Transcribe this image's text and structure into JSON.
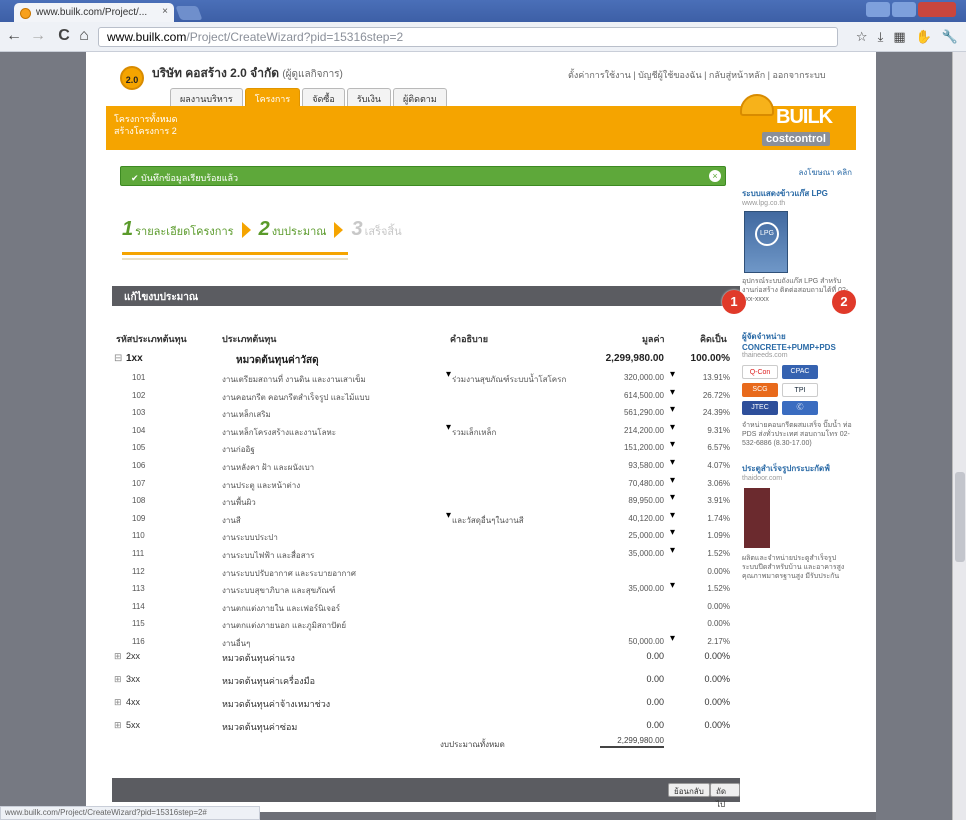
{
  "browser": {
    "tab_title": "www.builk.com/Project/...",
    "tab_close": "×",
    "url_host": "www.builk.com",
    "url_path": "/Project/CreateWizard?pid=15316step=2",
    "back": "←",
    "forward": "→",
    "reload": "C",
    "home": "⌂",
    "status_url": "www.builk.com/Project/CreateWizard?pid=15316step=2#"
  },
  "header": {
    "logo_badge": "2.0",
    "company_name": "บริษัท คอสร้าง 2.0 จำกัด",
    "company_sub": "(ผู้ดูแลกิจการ)",
    "top_links": "ตั้งค่าการใช้งาน | บัญชีผู้ใช้ของฉัน | กลับสู่หน้าหลัก | ออกจากระบบ",
    "menu": [
      "ผลงานบริหาร",
      "โครงการ",
      "จัดซื้อ",
      "รับเงิน",
      "ผู้ติดตาม"
    ],
    "breadcrumb_line1": "โครงการทั้งหมด",
    "breadcrumb_line2": "สร้างโครงการ 2",
    "brand_word": "BUILK",
    "brand_badge": "costcontrol"
  },
  "notice": {
    "text": "✔ บันทึกข้อมูลเรียบร้อยแล้ว",
    "close": "×"
  },
  "steps": [
    {
      "num": "1",
      "label": "รายละเอียดโครงการ"
    },
    {
      "num": "2",
      "label": "งบประมาณ"
    },
    {
      "num": "3",
      "label": "เสร็จสิ้น"
    }
  ],
  "section_title": "แก้ไขงบประมาณ",
  "columns": {
    "code": "รหัสประเภทต้นทุน",
    "type": "ประเภทต้นทุน",
    "desc": "คำอธิบาย",
    "amount": "มูลค่า",
    "percent": "คิดเป็น"
  },
  "main_group": {
    "code": "1xx",
    "name": "หมวดต้นทุนค่าวัสดุ",
    "amount": "2,299,980.00",
    "percent": "100.00%"
  },
  "rows": [
    {
      "code": "101",
      "name": "งานเตรียมสถานที่ งานดิน และงานเสาเข็ม",
      "desc": "ร่วมงานสุขภัณฑ์ระบบน้ำโสโครก",
      "amount": "320,000.00",
      "percent": "13.91%"
    },
    {
      "code": "102",
      "name": "งานคอนกรีต คอนกรีตสำเร็จรูป และไม้แบบ",
      "desc": "",
      "amount": "614,500.00",
      "percent": "26.72%"
    },
    {
      "code": "103",
      "name": "งานเหล็กเสริม",
      "desc": "",
      "amount": "561,290.00",
      "percent": "24.39%"
    },
    {
      "code": "104",
      "name": "งานเหล็กโครงสร้างและงานโลหะ",
      "desc": "รวมเล็กเหล็ก",
      "amount": "214,200.00",
      "percent": "9.31%"
    },
    {
      "code": "105",
      "name": "งานก่ออิฐ",
      "desc": "",
      "amount": "151,200.00",
      "percent": "6.57%"
    },
    {
      "code": "106",
      "name": "งานหลังคา ฝ้า และผนังเบา",
      "desc": "",
      "amount": "93,580.00",
      "percent": "4.07%"
    },
    {
      "code": "107",
      "name": "งานประตู และหน้าต่าง",
      "desc": "",
      "amount": "70,480.00",
      "percent": "3.06%"
    },
    {
      "code": "108",
      "name": "งานพื้นผิว",
      "desc": "",
      "amount": "89,950.00",
      "percent": "3.91%"
    },
    {
      "code": "109",
      "name": "งานสี",
      "desc": "และวัสดุอื่นๆในงานสี",
      "amount": "40,120.00",
      "percent": "1.74%"
    },
    {
      "code": "110",
      "name": "งานระบบประปา",
      "desc": "",
      "amount": "25,000.00",
      "percent": "1.09%"
    },
    {
      "code": "111",
      "name": "งานระบบไฟฟ้า และสื่อสาร",
      "desc": "",
      "amount": "35,000.00",
      "percent": "1.52%"
    },
    {
      "code": "112",
      "name": "งานระบบปรับอากาศ และระบายอากาศ",
      "desc": "",
      "amount": "",
      "percent": "0.00%"
    },
    {
      "code": "113",
      "name": "งานระบบสุขาภิบาล และสุขภัณฑ์",
      "desc": "",
      "amount": "35,000.00",
      "percent": "1.52%"
    },
    {
      "code": "114",
      "name": "งานตกแต่งภายใน และเฟอร์นิเจอร์",
      "desc": "",
      "amount": "",
      "percent": "0.00%"
    },
    {
      "code": "115",
      "name": "งานตกแต่งภายนอก และภูมิสถาปัตย์",
      "desc": "",
      "amount": "",
      "percent": "0.00%"
    },
    {
      "code": "116",
      "name": "งานอื่นๆ",
      "desc": "",
      "amount": "50,000.00",
      "percent": "2.17%"
    }
  ],
  "groups": [
    {
      "code": "2xx",
      "name": "หมวดต้นทุนค่าแรง",
      "amount": "0.00",
      "percent": "0.00%"
    },
    {
      "code": "3xx",
      "name": "หมวดต้นทุนค่าเครื่องมือ",
      "amount": "0.00",
      "percent": "0.00%"
    },
    {
      "code": "4xx",
      "name": "หมวดต้นทุนค่าจ้างเหมาช่วง",
      "amount": "0.00",
      "percent": "0.00%"
    },
    {
      "code": "5xx",
      "name": "หมวดต้นทุนค่าซ่อม",
      "amount": "0.00",
      "percent": "0.00%"
    }
  ],
  "total": {
    "label": "งบประมาณทั้งหมด",
    "value": "2,299,980.00"
  },
  "footer": {
    "back_label": "ย้อนกลับ",
    "next_label": "ถัดไป"
  },
  "sidebar": {
    "ad_label": "ลงโฆษณา คลิก",
    "item1_title": "ระบบแสดงข้าวแก๊ส LPG",
    "item1_sub": "www.lpg.co.th",
    "item1_image_text": "LPG",
    "item1_text": "อุปกรณ์ระบบถังแก๊ส LPG สำหรับงานก่อสร้าง ติดต่อสอบถามได้ที่ 02-xxx-xxxx",
    "item2_title": "ผู้จัดจำหน่าย CONCRETE+PUMP+PDS",
    "item2_sub": "thaineeds.com",
    "item2_text": "จำหน่ายคอนกรีตผสมเสร็จ ปั๊มน้ำ ท่อ PDS ส่งทั่วประเทศ สอบถามโทร 02-532-6886 (8.30-17.00)",
    "logos": [
      "Q-Con",
      "CPAC",
      "SCG",
      "TPI",
      "JTEC",
      "Ⓒ"
    ],
    "item3_title": "ประตูสำเร็จรูปกระบะกัดฟ์",
    "item3_sub": "thaidoor.com",
    "item3_text": "ผลิตและจำหน่ายประตูสำเร็จรูประบบปีดสำหรับบ้าน และอาคารสูง คุณภาพมาตรฐานสูง มีรับประกัน"
  },
  "markers": [
    "1",
    "2"
  ]
}
